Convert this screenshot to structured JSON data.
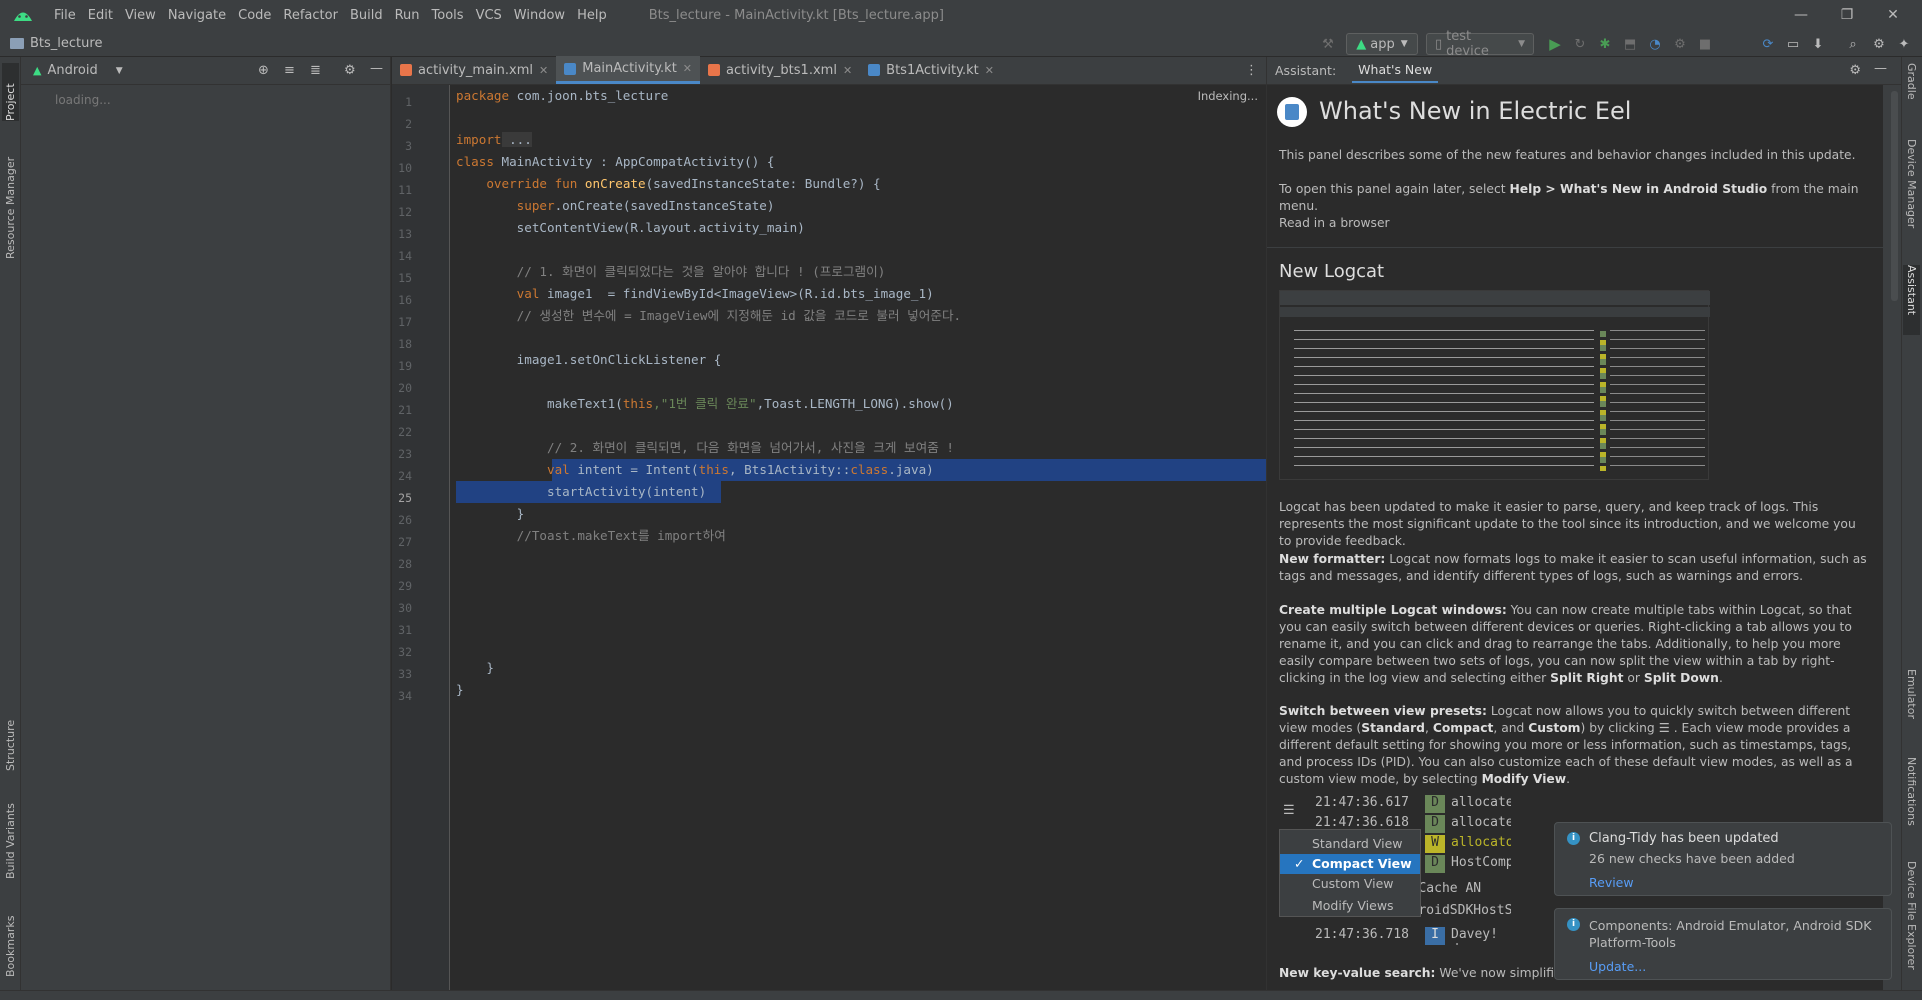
{
  "menubar": {
    "items": [
      "File",
      "Edit",
      "View",
      "Navigate",
      "Code",
      "Refactor",
      "Build",
      "Run",
      "Tools",
      "VCS",
      "Window",
      "Help"
    ],
    "window_title": "Bts_lecture - MainActivity.kt [Bts_lecture.app]",
    "minimize": "—",
    "maximize": "❐",
    "close": "✕"
  },
  "navbar": {
    "project_name": "Bts_lecture",
    "run_config": "app",
    "device": "test device"
  },
  "left_tabs": [
    "Project",
    "Resource Manager",
    "Structure",
    "Build Variants",
    "Bookmarks"
  ],
  "right_tabs": [
    "Gradle",
    "Device Manager",
    "Assistant",
    "Emulator",
    "Notifications",
    "Device File Explorer"
  ],
  "project_panel": {
    "view": "Android",
    "loading": "loading..."
  },
  "editor": {
    "tabs": [
      {
        "label": "activity_main.xml",
        "active": false,
        "icon_color": "#e8754a"
      },
      {
        "label": "MainActivity.kt",
        "active": true,
        "icon_color": "#4a88c7"
      },
      {
        "label": "activity_bts1.xml",
        "active": false,
        "icon_color": "#e8754a"
      },
      {
        "label": "Bts1Activity.kt",
        "active": false,
        "icon_color": "#4a88c7"
      }
    ],
    "indexing": "Indexing...",
    "line_numbers": [
      "1",
      "2",
      "3",
      "10",
      "11",
      "12",
      "13",
      "14",
      "15",
      "16",
      "17",
      "18",
      "19",
      "20",
      "21",
      "22",
      "23",
      "24",
      "25",
      "26",
      "27",
      "28",
      "29",
      "30",
      "31",
      "32",
      "33",
      "34"
    ],
    "current_line": "25",
    "code": {
      "l1_kw": "package",
      "l1_rest": " com.joon.bts_lecture",
      "l3_kw": "import",
      "l3_rest": " ...",
      "l10_kw": "class",
      "l10_rest": " MainActivity : AppCompatActivity() {",
      "l11_kw": "    override fun",
      "l11_fn": " onCreate",
      "l11_rest": "(savedInstanceState: Bundle?) {",
      "l12_kw": "        super",
      "l12_rest": ".onCreate(savedInstanceState)",
      "l13": "        setContentView(R.layout.activity_main)",
      "l15": "        // 1. 화면이 클릭되었다는 것을 알아야 합니다 ! (프로그램이)",
      "l16_kw": "        val",
      "l16_rest": " image1  = findViewById<ImageView>(R.id.bts_image_1)",
      "l17": "        // 생성한 변수에 = ImageView에 지정해둔 id 값을 코드로 불러 넣어준다.",
      "l19": "        image1.setOnClickListener {",
      "l21_a": "            makeText1(",
      "l21_kw": "this",
      "l21_str": ",\"1번 클릭 완료\"",
      "l21_rest": ",Toast.LENGTH_LONG).show()",
      "l23": "            // 2. 화면이 클릭되면, 다음 화면을 넘어가서, 사진을 크게 보여줌 !",
      "l24_kw": "            val",
      "l24_a": " intent = Intent(",
      "l24_kw2": "this",
      "l24_b": ", Bts1Activity::",
      "l24_kw3": "class",
      "l24_c": ".java)",
      "l25": "            startActivity(intent)",
      "l26": "        }",
      "l27": "        //Toast.makeText를 import하여",
      "l33": "    }",
      "l34": "}"
    }
  },
  "assistant": {
    "label": "Assistant:",
    "tab": "What's New",
    "title": "What's New in Electric Eel",
    "p1": "This panel describes some of the new features and behavior changes included in this update.",
    "p2_a": "To open this panel again later, select ",
    "p2_b": "Help > What's New in Android Studio",
    "p2_c": " from the main menu.",
    "read_browser": "Read in a browser",
    "logcat_title": "New Logcat",
    "logcat_p": "Logcat has been updated to make it easier to parse, query, and keep track of logs. This represents the most significant update to the tool since its introduction, and we welcome you to provide feedback.",
    "formatter_b": "New formatter:",
    "formatter_p": " Logcat now formats logs to make it easier to scan useful information, such as tags and messages, and identify different types of logs, such as warnings and errors.",
    "multi_b": "Create multiple Logcat windows:",
    "multi_p": " You can now create multiple tabs within Logcat, so that you can easily switch between different devices or queries. Right-clicking a tab allows you to rename it, and you can click and drag to rearrange the tabs. Additionally, to help you more easily compare between two sets of logs, you can now split the view within a tab by right-clicking in the log view and selecting either ",
    "multi_b2": "Split Right",
    "multi_or": " or ",
    "multi_b3": "Split Down",
    "multi_end": ".",
    "presets_b": "Switch between view presets:",
    "presets_p1": " Logcat now allows you to quickly switch between different view modes (",
    "presets_standard": "Standard",
    "presets_comma": ", ",
    "presets_compact": "Compact",
    "presets_and": ", and ",
    "presets_custom": "Custom",
    "presets_p2": ") by clicking",
    "presets_p3": ". Each view mode provides a different default setting for showing you more or less information, such as timestamps, tags, and process IDs (PID). You can also customize each of these default view modes, as well as a custom view mode, by selecting ",
    "presets_modify": "Modify View",
    "presets_end": ".",
    "kv_b": "New key-value search:",
    "kv_p": " We've now simplified the",
    "demo": {
      "times": [
        "21:47:36.617",
        "21:47:36.618",
        "21:47:36.718"
      ],
      "levels": [
        "D",
        "D",
        "W",
        "D",
        "I"
      ],
      "msgs": [
        "allocate",
        "allocate",
        "allocato",
        "HostComp",
        "UV_Cache AN",
        "AndroidSDKHostSide_tr",
        "Davey! d"
      ],
      "menu": [
        "Standard View",
        "Compact View",
        "Custom View",
        "Modify Views"
      ],
      "checked": "✓"
    }
  },
  "notifications": [
    {
      "title": "Clang-Tidy has been updated",
      "body": "26 new checks have been added",
      "link": "Review"
    },
    {
      "title": "Components: Android Emulator, Android SDK Platform-Tools",
      "link": "Update..."
    }
  ]
}
